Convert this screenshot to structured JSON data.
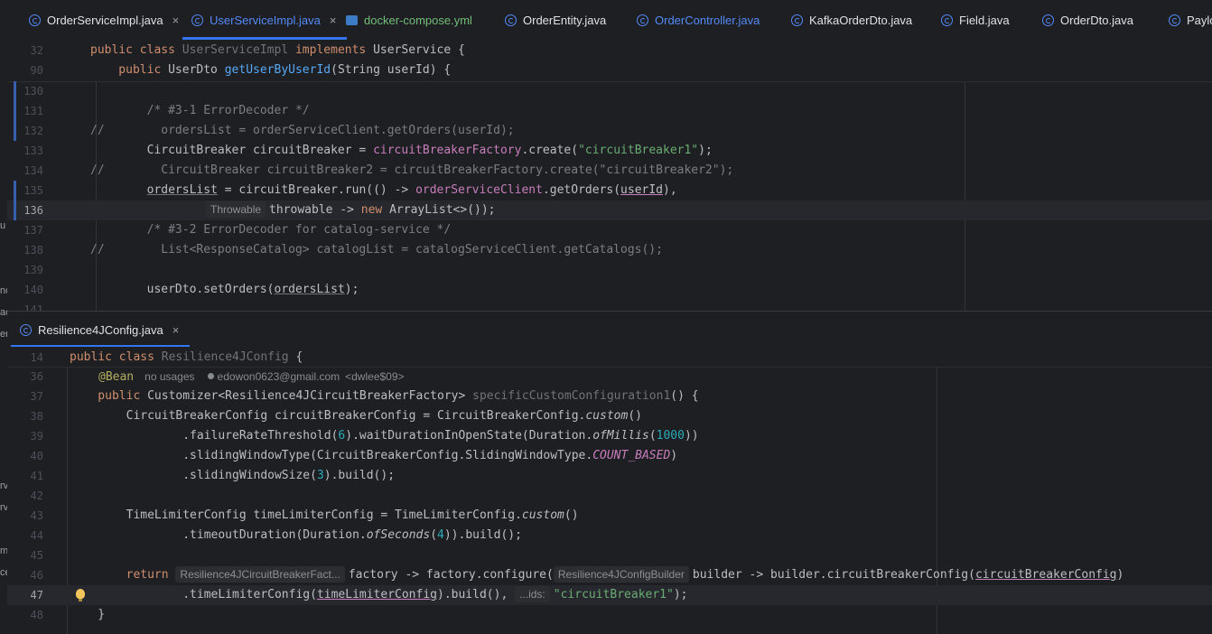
{
  "top_tabs": [
    {
      "label": "OrderServiceImpl.java",
      "icon": "class-icon",
      "closable": true,
      "active": false,
      "color": "default"
    },
    {
      "label": "UserServiceImpl.java",
      "icon": "class-icon",
      "closable": true,
      "active": true,
      "color": "blue"
    },
    {
      "label": "docker-compose.yml",
      "icon": "docker-icon",
      "closable": false,
      "active": false,
      "color": "green"
    },
    {
      "label": "OrderEntity.java",
      "icon": "class-icon",
      "closable": false,
      "active": false,
      "color": "default"
    },
    {
      "label": "OrderController.java",
      "icon": "class-icon",
      "closable": false,
      "active": false,
      "color": "blue"
    },
    {
      "label": "KafkaOrderDto.java",
      "icon": "class-icon",
      "closable": false,
      "active": false,
      "color": "default"
    },
    {
      "label": "Field.java",
      "icon": "class-icon",
      "closable": false,
      "active": false,
      "color": "default"
    },
    {
      "label": "OrderDto.java",
      "icon": "class-icon",
      "closable": false,
      "active": false,
      "color": "default"
    },
    {
      "label": "Payloa",
      "icon": "class-icon",
      "closable": false,
      "active": false,
      "color": "default"
    }
  ],
  "bottom_tabs": [
    {
      "label": "Resilience4JConfig.java",
      "icon": "class-icon",
      "closable": true,
      "active": true
    }
  ],
  "close_glyph": "×",
  "left_strip_fragments": [
    "u",
    "nc",
    "ac",
    "er",
    "rv",
    "rv",
    "m",
    "ce"
  ],
  "top_editor": {
    "sticky": [
      {
        "ln": "32",
        "t": [
          [
            "public class ",
            "kw"
          ],
          [
            "UserServiceImpl ",
            "grey"
          ],
          [
            "implements ",
            "kw"
          ],
          [
            "UserService {",
            ""
          ]
        ]
      },
      {
        "ln": "90",
        "t": [
          [
            "    public ",
            "kw"
          ],
          [
            "UserDto ",
            ""
          ],
          [
            "getUserByUserId",
            "fn"
          ],
          [
            "(String userId) {",
            ""
          ]
        ]
      }
    ],
    "lines": [
      {
        "ln": "130",
        "t": []
      },
      {
        "ln": "131",
        "t": [
          [
            "        /* #3-1 ErrorDecoder */",
            "cm"
          ]
        ]
      },
      {
        "ln": "132",
        "t": [
          [
            "//        ordersList = orderServiceClient.getOrders(userId);",
            "cm"
          ]
        ]
      },
      {
        "ln": "133",
        "t": [
          [
            "        CircuitBreaker circuitBreaker = ",
            ""
          ],
          [
            "circuitBreakerFactory",
            "field"
          ],
          [
            ".create(",
            ""
          ],
          [
            "\"circuitBreaker1\"",
            "str"
          ],
          [
            ");",
            ""
          ]
        ]
      },
      {
        "ln": "134",
        "t": [
          [
            "//        CircuitBreaker circuitBreaker2 = circuitBreakerFactory.create(\"circuitBreaker2\");",
            "cm"
          ]
        ]
      },
      {
        "ln": "135",
        "t": [
          [
            "        ",
            ""
          ],
          [
            "ordersList",
            "ul"
          ],
          [
            " = circuitBreaker.run(() -> ",
            ""
          ],
          [
            "orderServiceClient",
            "field"
          ],
          [
            ".getOrders(",
            ""
          ],
          [
            "userId",
            "ulr"
          ],
          [
            "),",
            ""
          ]
        ]
      },
      {
        "ln": "136",
        "cur": true,
        "hint": "Throwable",
        "t": [
          [
            "throwable -> ",
            ""
          ],
          [
            "new ",
            "kw"
          ],
          [
            "ArrayList",
            ""
          ],
          [
            "<>());",
            ""
          ]
        ]
      },
      {
        "ln": "137",
        "t": [
          [
            "        /* #3-2 ErrorDecoder for catalog-service */",
            "cm"
          ]
        ]
      },
      {
        "ln": "138",
        "t": [
          [
            "//        List<ResponseCatalog> catalogList = catalogServiceClient.getCatalogs();",
            "cm"
          ]
        ]
      },
      {
        "ln": "139",
        "t": []
      },
      {
        "ln": "140",
        "t": [
          [
            "        userDto.setOrders(",
            ""
          ],
          [
            "ordersList",
            "ul"
          ],
          [
            ");",
            ""
          ]
        ]
      },
      {
        "ln": "141",
        "t": []
      }
    ]
  },
  "bottom_editor": {
    "sticky": [
      {
        "ln": "14",
        "t": [
          [
            "public class ",
            "kw"
          ],
          [
            "Resilience4JConfig ",
            "grey"
          ],
          [
            "{",
            ""
          ]
        ]
      }
    ],
    "meta_line": {
      "ln": "36",
      "annotation": "@Bean",
      "usages": "no usages",
      "author": "edowon0623@gmail.com",
      "alias": "<dwlee$09>"
    },
    "lines": [
      {
        "ln": "37",
        "t": [
          [
            "    public ",
            "kw"
          ],
          [
            "Customizer<Resilience4JCircuitBreakerFactory> ",
            ""
          ],
          [
            "specificCustomConfiguration1",
            "grey"
          ],
          [
            "() {",
            ""
          ]
        ]
      },
      {
        "ln": "38",
        "t": [
          [
            "        CircuitBreakerConfig circuitBreakerConfig = CircuitBreakerConfig.",
            ""
          ],
          [
            "custom",
            "it"
          ],
          [
            "()",
            ""
          ]
        ]
      },
      {
        "ln": "39",
        "t": [
          [
            "                .failureRateThreshold(",
            ""
          ],
          [
            "6",
            "num"
          ],
          [
            ").waitDurationInOpenState(Duration.",
            ""
          ],
          [
            "ofMillis",
            "it"
          ],
          [
            "(",
            ""
          ],
          [
            "1000",
            "num"
          ],
          [
            "))",
            ""
          ]
        ]
      },
      {
        "ln": "40",
        "t": [
          [
            "                .slidingWindowType(CircuitBreakerConfig.SlidingWindowType.",
            ""
          ],
          [
            "COUNT_BASED",
            "itf"
          ],
          [
            ")",
            ""
          ]
        ]
      },
      {
        "ln": "41",
        "t": [
          [
            "                .slidingWindowSize(",
            ""
          ],
          [
            "3",
            "num"
          ],
          [
            ").build();",
            ""
          ]
        ]
      },
      {
        "ln": "42",
        "t": []
      },
      {
        "ln": "43",
        "t": [
          [
            "        TimeLimiterConfig timeLimiterConfig = TimeLimiterConfig.",
            ""
          ],
          [
            "custom",
            "it"
          ],
          [
            "()",
            ""
          ]
        ]
      },
      {
        "ln": "44",
        "t": [
          [
            "                .timeoutDuration(Duration.",
            ""
          ],
          [
            "ofSeconds",
            "it"
          ],
          [
            "(",
            ""
          ],
          [
            "4",
            "num"
          ],
          [
            ")).build();",
            ""
          ]
        ]
      },
      {
        "ln": "45",
        "t": []
      },
      {
        "ln": "46",
        "hints": [
          "Resilience4JCircuitBreakerFact...",
          "Resilience4JConfigBuilder"
        ],
        "t": []
      },
      {
        "ln": "47",
        "cur": true,
        "bulb": true,
        "t": []
      },
      {
        "ln": "48",
        "t": [
          [
            "    }",
            ""
          ]
        ]
      }
    ],
    "line46": {
      "kw_return": "return ",
      "mid": "factory -> factory.configure(",
      "tail": "builder -> builder.circuitBreakerConfig(",
      "arg": "circuitBreakerConfig",
      "end": ")"
    },
    "line47": {
      "pre": "                .timeLimiterConfig(",
      "arg": "timeLimiterConfig",
      "mid": ").build(), ",
      "hint": "...ids:",
      "str": "\"circuitBreaker1\"",
      "end": ");"
    }
  }
}
